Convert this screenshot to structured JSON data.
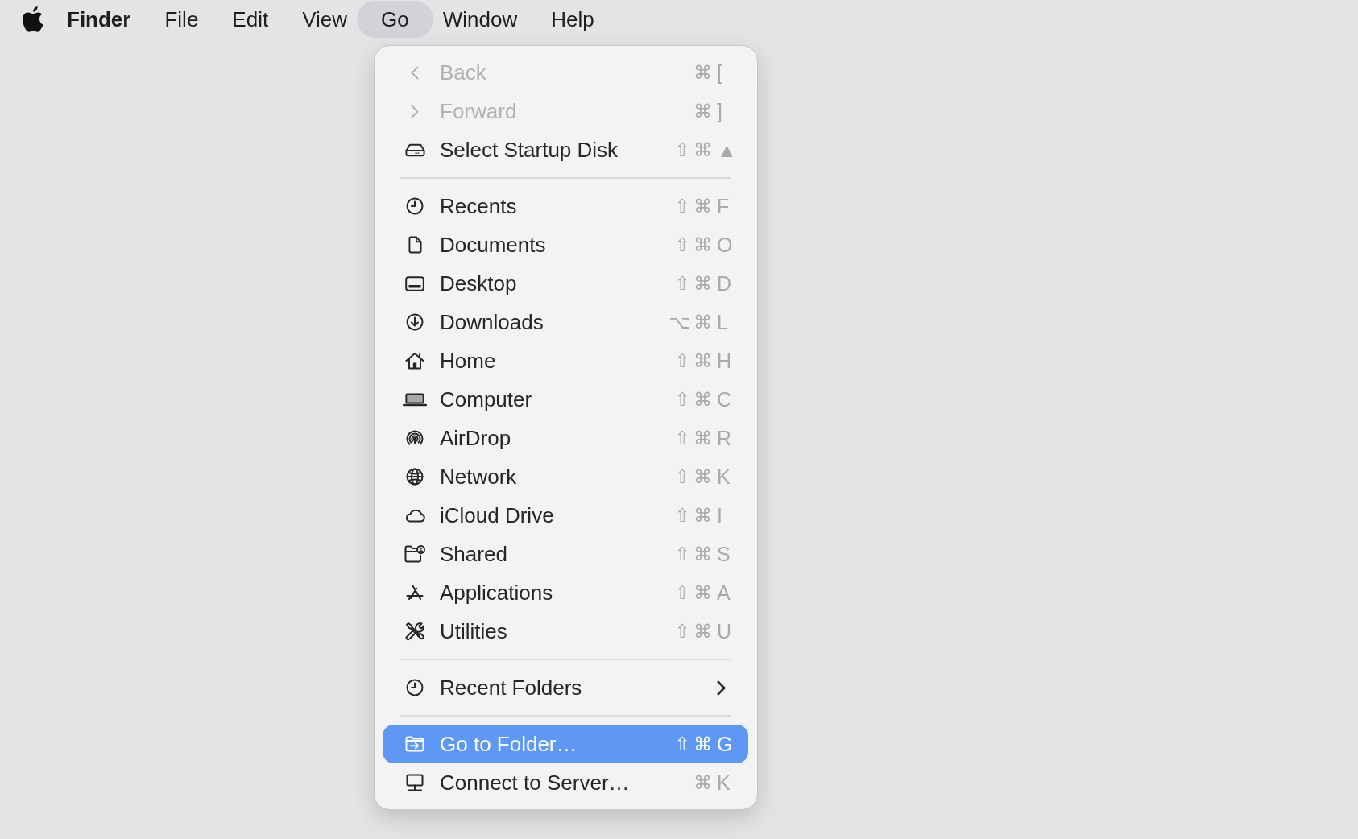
{
  "menubar": {
    "menus": [
      {
        "label": "Finder",
        "kind": "app",
        "selected": false
      },
      {
        "label": "File",
        "kind": "menu",
        "selected": false
      },
      {
        "label": "Edit",
        "kind": "menu",
        "selected": false
      },
      {
        "label": "View",
        "kind": "menu",
        "selected": false
      },
      {
        "label": "Go",
        "kind": "menu",
        "selected": true
      },
      {
        "label": "Window",
        "kind": "menu",
        "selected": false
      },
      {
        "label": "Help",
        "kind": "menu",
        "selected": false
      }
    ]
  },
  "go_menu": {
    "items": [
      {
        "kind": "item",
        "label": "Back",
        "disabled": true,
        "selected": false,
        "submenu": false,
        "shortcut": {
          "modifiers": "⌘",
          "key": "["
        }
      },
      {
        "kind": "item",
        "label": "Forward",
        "disabled": true,
        "selected": false,
        "submenu": false,
        "shortcut": {
          "modifiers": "⌘",
          "key": "]"
        }
      },
      {
        "kind": "item",
        "label": "Select Startup Disk",
        "disabled": false,
        "selected": false,
        "submenu": false,
        "shortcut": {
          "modifiers": "⇧ ⌘",
          "key": "▲"
        }
      },
      {
        "kind": "separator"
      },
      {
        "kind": "item",
        "label": "Recents",
        "disabled": false,
        "selected": false,
        "submenu": false,
        "shortcut": {
          "modifiers": "⇧ ⌘",
          "key": "F"
        }
      },
      {
        "kind": "item",
        "label": "Documents",
        "disabled": false,
        "selected": false,
        "submenu": false,
        "shortcut": {
          "modifiers": "⇧ ⌘",
          "key": "O"
        }
      },
      {
        "kind": "item",
        "label": "Desktop",
        "disabled": false,
        "selected": false,
        "submenu": false,
        "shortcut": {
          "modifiers": "⇧ ⌘",
          "key": "D"
        }
      },
      {
        "kind": "item",
        "label": "Downloads",
        "disabled": false,
        "selected": false,
        "submenu": false,
        "shortcut": {
          "modifiers": "⌥ ⌘",
          "key": "L"
        }
      },
      {
        "kind": "item",
        "label": "Home",
        "disabled": false,
        "selected": false,
        "submenu": false,
        "shortcut": {
          "modifiers": "⇧ ⌘",
          "key": "H"
        }
      },
      {
        "kind": "item",
        "label": "Computer",
        "disabled": false,
        "selected": false,
        "submenu": false,
        "shortcut": {
          "modifiers": "⇧ ⌘",
          "key": "C"
        }
      },
      {
        "kind": "item",
        "label": "AirDrop",
        "disabled": false,
        "selected": false,
        "submenu": false,
        "shortcut": {
          "modifiers": "⇧ ⌘",
          "key": "R"
        }
      },
      {
        "kind": "item",
        "label": "Network",
        "disabled": false,
        "selected": false,
        "submenu": false,
        "shortcut": {
          "modifiers": "⇧ ⌘",
          "key": "K"
        }
      },
      {
        "kind": "item",
        "label": "iCloud Drive",
        "disabled": false,
        "selected": false,
        "submenu": false,
        "shortcut": {
          "modifiers": "⇧ ⌘",
          "key": "I"
        }
      },
      {
        "kind": "item",
        "label": "Shared",
        "disabled": false,
        "selected": false,
        "submenu": false,
        "shortcut": {
          "modifiers": "⇧ ⌘",
          "key": "S"
        }
      },
      {
        "kind": "item",
        "label": "Applications",
        "disabled": false,
        "selected": false,
        "submenu": false,
        "shortcut": {
          "modifiers": "⇧ ⌘",
          "key": "A"
        }
      },
      {
        "kind": "item",
        "label": "Utilities",
        "disabled": false,
        "selected": false,
        "submenu": false,
        "shortcut": {
          "modifiers": "⇧ ⌘",
          "key": "U"
        }
      },
      {
        "kind": "separator"
      },
      {
        "kind": "item",
        "label": "Recent Folders",
        "disabled": false,
        "selected": false,
        "submenu": true
      },
      {
        "kind": "separator"
      },
      {
        "kind": "item",
        "label": "Go to Folder…",
        "disabled": false,
        "selected": true,
        "submenu": false,
        "shortcut": {
          "modifiers": "⇧ ⌘",
          "key": "G"
        }
      },
      {
        "kind": "item",
        "label": "Connect to Server…",
        "disabled": false,
        "selected": false,
        "submenu": false,
        "shortcut": {
          "modifiers": "⌘",
          "key": "K"
        }
      }
    ]
  }
}
